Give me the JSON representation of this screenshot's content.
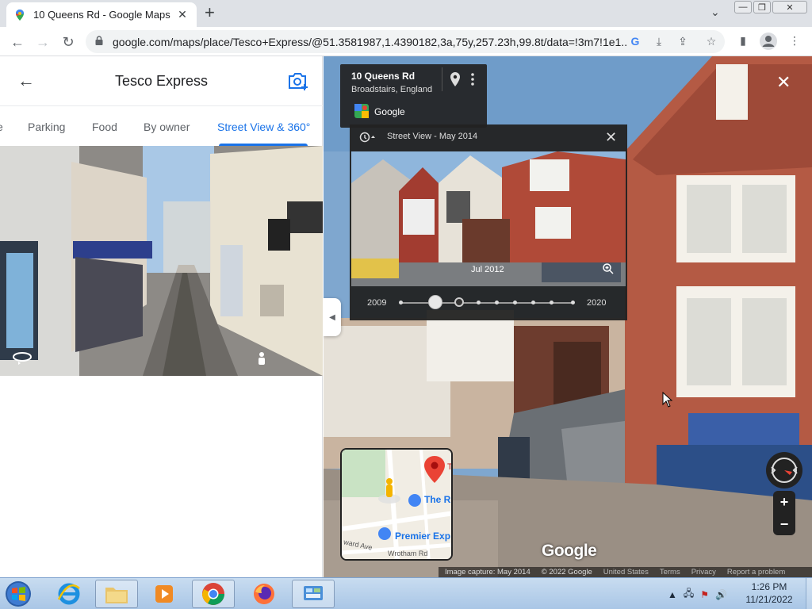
{
  "browser": {
    "tab_title": "10 Queens Rd - Google Maps",
    "url": "google.com/maps/place/Tesco+Express/@51.3581987,1.4390182,3a,75y,257.23h,99.8t/data=!3m7!1e1..."
  },
  "place_panel": {
    "title": "Tesco Express",
    "tabs": [
      {
        "label": "e"
      },
      {
        "label": "Parking"
      },
      {
        "label": "Food"
      },
      {
        "label": "By owner"
      },
      {
        "label": "Street View & 360°"
      }
    ]
  },
  "street_view": {
    "address_line1": "10 Queens Rd",
    "address_line2": "Broadstairs, England",
    "provider": "Google",
    "time_machine": {
      "title": "Street View - May 2014",
      "selected_date": "Jul 2012",
      "year_start": "2009",
      "year_end": "2020"
    },
    "minimap": {
      "label_the": "The R",
      "label_premier": "Premier Exp",
      "label_road1": "ward Ave",
      "label_road2": "Wrotham Rd",
      "label_t": "T"
    },
    "watermark": "Google",
    "footer": {
      "capture": "Image capture: May 2014",
      "copyright": "© 2022 Google",
      "country": "United States",
      "terms": "Terms",
      "privacy": "Privacy",
      "report": "Report a problem"
    }
  },
  "taskbar": {
    "time": "1:26 PM",
    "date": "11/21/2022"
  },
  "colors": {
    "accent": "#1a73e8",
    "panel_dark": "#222222",
    "pin_red": "#ea4335"
  }
}
